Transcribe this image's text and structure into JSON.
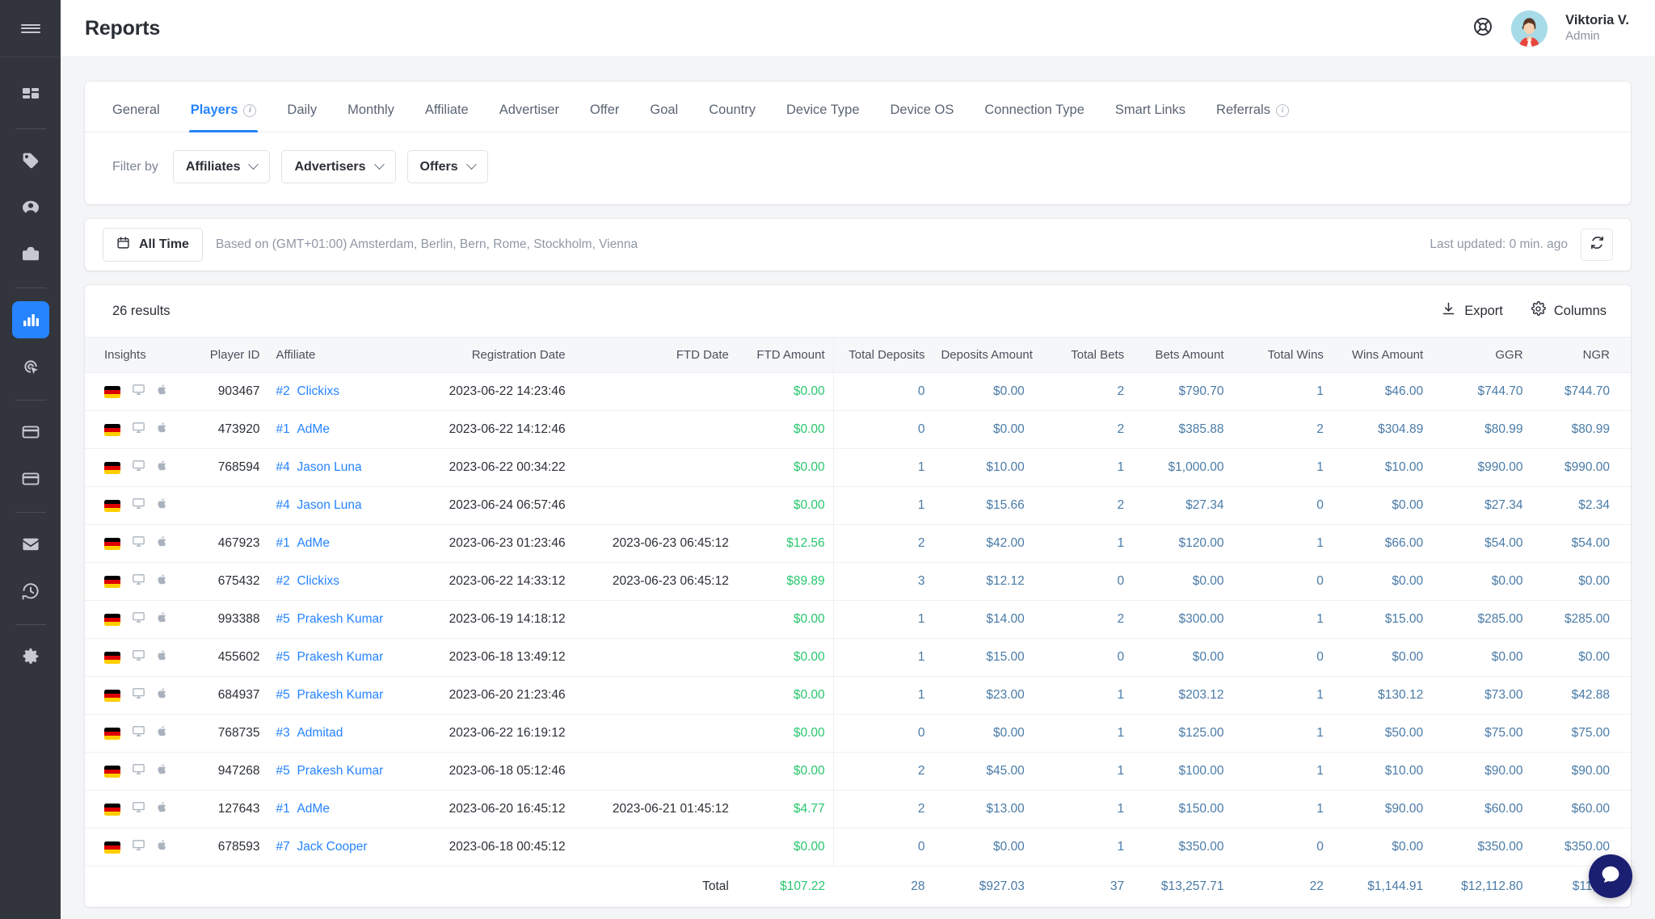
{
  "sidebar": {
    "menu_icon": "hamburger-menu-icon",
    "items": [
      {
        "name": "dashboard",
        "icon": "dashboard-grid-icon",
        "active": false
      },
      {
        "name": "offers",
        "icon": "tag-icon",
        "active": false
      },
      {
        "name": "affiliates",
        "icon": "user-circle-icon",
        "active": false
      },
      {
        "name": "advertisers",
        "icon": "briefcase-icon",
        "active": false
      },
      {
        "name": "reports",
        "icon": "bar-chart-icon",
        "active": true
      },
      {
        "name": "tracking",
        "icon": "radar-cursor-icon",
        "active": false
      },
      {
        "name": "billing",
        "icon": "credit-card-icon",
        "active": false
      },
      {
        "name": "payments",
        "icon": "credit-card-icon",
        "active": false
      },
      {
        "name": "messages",
        "icon": "envelope-icon",
        "active": false
      },
      {
        "name": "history",
        "icon": "clock-history-icon",
        "active": false
      },
      {
        "name": "settings",
        "icon": "gear-icon",
        "active": false
      }
    ]
  },
  "header": {
    "title": "Reports",
    "help_icon": "lifebuoy-icon",
    "user_name": "Viktoria V.",
    "user_role": "Admin"
  },
  "tabs": [
    {
      "label": "General",
      "active": false,
      "info": false
    },
    {
      "label": "Players",
      "active": true,
      "info": true
    },
    {
      "label": "Daily",
      "active": false,
      "info": false
    },
    {
      "label": "Monthly",
      "active": false,
      "info": false
    },
    {
      "label": "Affiliate",
      "active": false,
      "info": false
    },
    {
      "label": "Advertiser",
      "active": false,
      "info": false
    },
    {
      "label": "Offer",
      "active": false,
      "info": false
    },
    {
      "label": "Goal",
      "active": false,
      "info": false
    },
    {
      "label": "Country",
      "active": false,
      "info": false
    },
    {
      "label": "Device Type",
      "active": false,
      "info": false
    },
    {
      "label": "Device OS",
      "active": false,
      "info": false
    },
    {
      "label": "Connection Type",
      "active": false,
      "info": false
    },
    {
      "label": "Smart Links",
      "active": false,
      "info": false
    },
    {
      "label": "Referrals",
      "active": false,
      "info": true
    }
  ],
  "filters": {
    "label": "Filter by",
    "selects": [
      {
        "label": "Affiliates"
      },
      {
        "label": "Advertisers"
      },
      {
        "label": "Offers"
      }
    ]
  },
  "date_bar": {
    "range_label": "All Time",
    "calendar_icon": "calendar-icon",
    "timezone_text": "Based on (GMT+01:00) Amsterdam, Berlin, Bern, Rome, Stockholm, Vienna",
    "last_updated": "Last updated: 0 min. ago",
    "refresh_icon": "refresh-icon"
  },
  "table_tools": {
    "results": "26 results",
    "export_label": "Export",
    "export_icon": "download-icon",
    "columns_label": "Columns",
    "columns_icon": "gear-icon"
  },
  "table": {
    "columns": [
      "Insights",
      "Player ID",
      "Affiliate",
      "Registration Date",
      "FTD Date",
      "FTD Amount",
      "Total Deposits",
      "Deposits Amount",
      "Total Bets",
      "Bets Amount",
      "Total Wins",
      "Wins Amount",
      "GGR",
      "NGR"
    ],
    "rows": [
      {
        "flag": "de",
        "device": "desktop-icon",
        "os": "apple-icon",
        "player_id": "903467",
        "aff_rank": "#2",
        "aff_name": "Clickixs",
        "registration_date": "2023-06-22 14:23:46",
        "ftd_date": "",
        "ftd_amount": "$0.00",
        "total_deposits": "0",
        "deposits_amount": "$0.00",
        "total_bets": "2",
        "bets_amount": "$790.70",
        "total_wins": "1",
        "wins_amount": "$46.00",
        "ggr": "$744.70",
        "ngr": "$744.70"
      },
      {
        "flag": "de",
        "device": "desktop-icon",
        "os": "apple-icon",
        "player_id": "473920",
        "aff_rank": "#1",
        "aff_name": "AdMe",
        "registration_date": "2023-06-22 14:12:46",
        "ftd_date": "",
        "ftd_amount": "$0.00",
        "total_deposits": "0",
        "deposits_amount": "$0.00",
        "total_bets": "2",
        "bets_amount": "$385.88",
        "total_wins": "2",
        "wins_amount": "$304.89",
        "ggr": "$80.99",
        "ngr": "$80.99"
      },
      {
        "flag": "de",
        "device": "desktop-icon",
        "os": "apple-icon",
        "player_id": "768594",
        "aff_rank": "#4",
        "aff_name": "Jason Luna",
        "registration_date": "2023-06-22 00:34:22",
        "ftd_date": "",
        "ftd_amount": "$0.00",
        "total_deposits": "1",
        "deposits_amount": "$10.00",
        "total_bets": "1",
        "bets_amount": "$1,000.00",
        "total_wins": "1",
        "wins_amount": "$10.00",
        "ggr": "$990.00",
        "ngr": "$990.00"
      },
      {
        "flag": "de",
        "device": "desktop-icon",
        "os": "apple-icon",
        "player_id": "",
        "aff_rank": "#4",
        "aff_name": "Jason Luna",
        "registration_date": "2023-06-24 06:57:46",
        "ftd_date": "",
        "ftd_amount": "$0.00",
        "total_deposits": "1",
        "deposits_amount": "$15.66",
        "total_bets": "2",
        "bets_amount": "$27.34",
        "total_wins": "0",
        "wins_amount": "$0.00",
        "ggr": "$27.34",
        "ngr": "$2.34"
      },
      {
        "flag": "de",
        "device": "desktop-icon",
        "os": "apple-icon",
        "player_id": "467923",
        "aff_rank": "#1",
        "aff_name": "AdMe",
        "registration_date": "2023-06-23 01:23:46",
        "ftd_date": "2023-06-23 06:45:12",
        "ftd_amount": "$12.56",
        "total_deposits": "2",
        "deposits_amount": "$42.00",
        "total_bets": "1",
        "bets_amount": "$120.00",
        "total_wins": "1",
        "wins_amount": "$66.00",
        "ggr": "$54.00",
        "ngr": "$54.00"
      },
      {
        "flag": "de",
        "device": "desktop-icon",
        "os": "apple-icon",
        "player_id": "675432",
        "aff_rank": "#2",
        "aff_name": "Clickixs",
        "registration_date": "2023-06-22 14:33:12",
        "ftd_date": "2023-06-23 06:45:12",
        "ftd_amount": "$89.89",
        "total_deposits": "3",
        "deposits_amount": "$12.12",
        "total_bets": "0",
        "bets_amount": "$0.00",
        "total_wins": "0",
        "wins_amount": "$0.00",
        "ggr": "$0.00",
        "ngr": "$0.00"
      },
      {
        "flag": "de",
        "device": "desktop-icon",
        "os": "apple-icon",
        "player_id": "993388",
        "aff_rank": "#5",
        "aff_name": "Prakesh Kumar",
        "registration_date": "2023-06-19 14:18:12",
        "ftd_date": "",
        "ftd_amount": "$0.00",
        "total_deposits": "1",
        "deposits_amount": "$14.00",
        "total_bets": "2",
        "bets_amount": "$300.00",
        "total_wins": "1",
        "wins_amount": "$15.00",
        "ggr": "$285.00",
        "ngr": "$285.00"
      },
      {
        "flag": "de",
        "device": "desktop-icon",
        "os": "apple-icon",
        "player_id": "455602",
        "aff_rank": "#5",
        "aff_name": "Prakesh Kumar",
        "registration_date": "2023-06-18 13:49:12",
        "ftd_date": "",
        "ftd_amount": "$0.00",
        "total_deposits": "1",
        "deposits_amount": "$15.00",
        "total_bets": "0",
        "bets_amount": "$0.00",
        "total_wins": "0",
        "wins_amount": "$0.00",
        "ggr": "$0.00",
        "ngr": "$0.00"
      },
      {
        "flag": "de",
        "device": "desktop-icon",
        "os": "apple-icon",
        "player_id": "684937",
        "aff_rank": "#5",
        "aff_name": "Prakesh Kumar",
        "registration_date": "2023-06-20 21:23:46",
        "ftd_date": "",
        "ftd_amount": "$0.00",
        "total_deposits": "1",
        "deposits_amount": "$23.00",
        "total_bets": "1",
        "bets_amount": "$203.12",
        "total_wins": "1",
        "wins_amount": "$130.12",
        "ggr": "$73.00",
        "ngr": "$42.88"
      },
      {
        "flag": "de",
        "device": "desktop-icon",
        "os": "apple-icon",
        "player_id": "768735",
        "aff_rank": "#3",
        "aff_name": "Admitad",
        "registration_date": "2023-06-22 16:19:12",
        "ftd_date": "",
        "ftd_amount": "$0.00",
        "total_deposits": "0",
        "deposits_amount": "$0.00",
        "total_bets": "1",
        "bets_amount": "$125.00",
        "total_wins": "1",
        "wins_amount": "$50.00",
        "ggr": "$75.00",
        "ngr": "$75.00"
      },
      {
        "flag": "de",
        "device": "desktop-icon",
        "os": "apple-icon",
        "player_id": "947268",
        "aff_rank": "#5",
        "aff_name": "Prakesh Kumar",
        "registration_date": "2023-06-18 05:12:46",
        "ftd_date": "",
        "ftd_amount": "$0.00",
        "total_deposits": "2",
        "deposits_amount": "$45.00",
        "total_bets": "1",
        "bets_amount": "$100.00",
        "total_wins": "1",
        "wins_amount": "$10.00",
        "ggr": "$90.00",
        "ngr": "$90.00"
      },
      {
        "flag": "de",
        "device": "desktop-icon",
        "os": "apple-icon",
        "player_id": "127643",
        "aff_rank": "#1",
        "aff_name": "AdMe",
        "registration_date": "2023-06-20 16:45:12",
        "ftd_date": "2023-06-21 01:45:12",
        "ftd_amount": "$4.77",
        "total_deposits": "2",
        "deposits_amount": "$13.00",
        "total_bets": "1",
        "bets_amount": "$150.00",
        "total_wins": "1",
        "wins_amount": "$90.00",
        "ggr": "$60.00",
        "ngr": "$60.00"
      },
      {
        "flag": "de",
        "device": "desktop-icon",
        "os": "apple-icon",
        "player_id": "678593",
        "aff_rank": "#7",
        "aff_name": "Jack Cooper",
        "registration_date": "2023-06-18 00:45:12",
        "ftd_date": "",
        "ftd_amount": "$0.00",
        "total_deposits": "0",
        "deposits_amount": "$0.00",
        "total_bets": "1",
        "bets_amount": "$350.00",
        "total_wins": "0",
        "wins_amount": "$0.00",
        "ggr": "$350.00",
        "ngr": "$350.00"
      }
    ],
    "totals": {
      "label": "Total",
      "ftd_amount": "$107.22",
      "total_deposits": "28",
      "deposits_amount": "$927.03",
      "total_bets": "37",
      "bets_amount": "$13,257.71",
      "total_wins": "22",
      "wins_amount": "$1,144.91",
      "ggr": "$12,112.80",
      "ngr": "$11,81"
    }
  },
  "chat": {
    "icon": "chat-bubble-icon"
  },
  "colors": {
    "accent": "#2684ff",
    "money_green": "#28c76f",
    "num_blue": "#4a7ba7",
    "sidebar_bg": "#32363c"
  }
}
